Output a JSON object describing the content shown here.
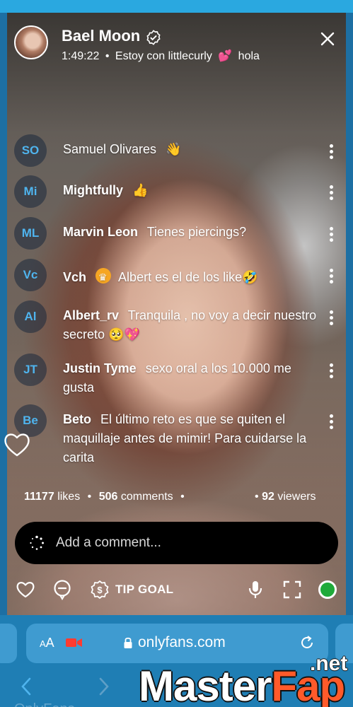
{
  "stream": {
    "streamer_name": "Bael Moon",
    "elapsed": "1:49:22",
    "separator": "•",
    "status_text": "Estoy con littlecurly",
    "status_emoji": "💕",
    "status_suffix": "hola"
  },
  "comments": [
    {
      "initials": "SO",
      "user": "Samuel Olivares",
      "message": "👋"
    },
    {
      "initials": "Mi",
      "user": "Mightfully",
      "message": "👍"
    },
    {
      "initials": "ML",
      "user": "Marvin Leon",
      "message": "Tienes piercings?"
    },
    {
      "initials": "Vc",
      "user": "Vch",
      "message": "Albert es el de los like🤣"
    },
    {
      "initials": "Al",
      "user": "Albert_rv",
      "message": "Tranquila , no voy a decir nuestro secreto 🥺💖"
    },
    {
      "initials": "JT",
      "user": "Justin Tyme",
      "message": "sexo oral a los 10.000 me gusta"
    },
    {
      "initials": "Be",
      "user": "Beto",
      "message": "El último reto es que se quiten el maquillaje antes de mimir! Para cuidarse la carita"
    }
  ],
  "stats": {
    "likes_count": "11177",
    "likes_label": "likes",
    "comments_count": "506",
    "comments_label": "comments",
    "viewers_count": "92",
    "viewers_label": "viewers",
    "dot": "•"
  },
  "comment_input": {
    "placeholder": "Add a comment..."
  },
  "toolbar": {
    "tip_goal_label": "TIP GOAL"
  },
  "browser": {
    "aa_small": "A",
    "aa_large": "A",
    "url": "onlyfans.com",
    "under_text": "OnlyFans"
  },
  "watermark": {
    "master": "Master",
    "fap": "Fap",
    "net": ".net"
  },
  "colors": {
    "accent_blue": "#4fb4ee",
    "live_green": "#1faa3a",
    "crown_orange": "#f6a623",
    "browser_bg": "#1f7eb4"
  },
  "icons": [
    "verified-icon",
    "close-icon",
    "more-icon",
    "crown-icon",
    "heart-icon",
    "spinner-icon",
    "emoji-icon",
    "dollar-icon",
    "mic-icon",
    "fullscreen-icon",
    "record-icon",
    "camera-icon",
    "lock-icon",
    "reload-icon",
    "back-icon",
    "forward-icon"
  ]
}
